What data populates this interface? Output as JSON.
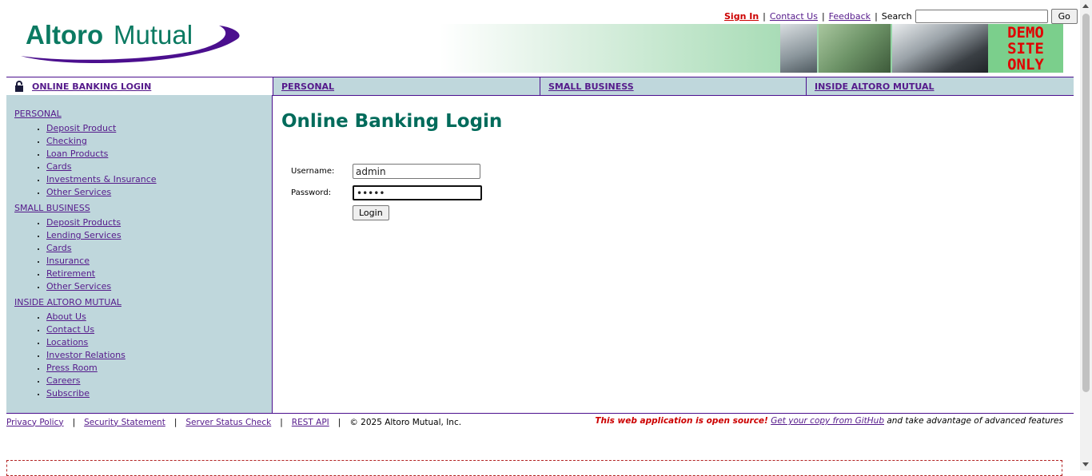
{
  "header": {
    "logo_text": "AltoroMutual",
    "links": {
      "sign_in": "Sign In",
      "contact_us": "Contact Us",
      "feedback": "Feedback",
      "search_label": "Search",
      "search_value": "",
      "go_button": "Go"
    },
    "banner": {
      "demo_lines": [
        "DEMO",
        "SITE",
        "ONLY"
      ]
    }
  },
  "topnav": {
    "login": "ONLINE BANKING LOGIN",
    "personal": "PERSONAL",
    "small_business": "SMALL BUSINESS",
    "inside": "INSIDE ALTORO MUTUAL"
  },
  "sidebar": {
    "sections": [
      {
        "title": "PERSONAL",
        "items": [
          "Deposit Product",
          "Checking",
          "Loan Products",
          "Cards",
          "Investments & Insurance",
          "Other Services"
        ]
      },
      {
        "title": "SMALL BUSINESS",
        "items": [
          "Deposit Products",
          "Lending Services",
          "Cards",
          "Insurance",
          "Retirement",
          "Other Services"
        ]
      },
      {
        "title": "INSIDE ALTORO MUTUAL",
        "items": [
          "About Us",
          "Contact Us",
          "Locations",
          "Investor Relations",
          "Press Room",
          "Careers",
          "Subscribe"
        ]
      }
    ]
  },
  "main": {
    "title": "Online Banking Login",
    "username_label": "Username:",
    "username_value": "admin",
    "password_label": "Password:",
    "password_value": "•••••",
    "login_button": "Login"
  },
  "footer": {
    "privacy": "Privacy Policy",
    "security": "Security Statement",
    "status": "Server Status Check",
    "api": "REST API",
    "copyright": "© 2025 Altoro Mutual, Inc.",
    "open_source": "This web application is open source!",
    "github": "Get your copy from GitHub",
    "advantage": "and take advantage of advanced features"
  },
  "colors": {
    "brand_green": "#006b5b",
    "brand_purple": "#4b0f8e",
    "sidebar_bg": "#bfd7dc",
    "alert_red": "#cc0000"
  }
}
